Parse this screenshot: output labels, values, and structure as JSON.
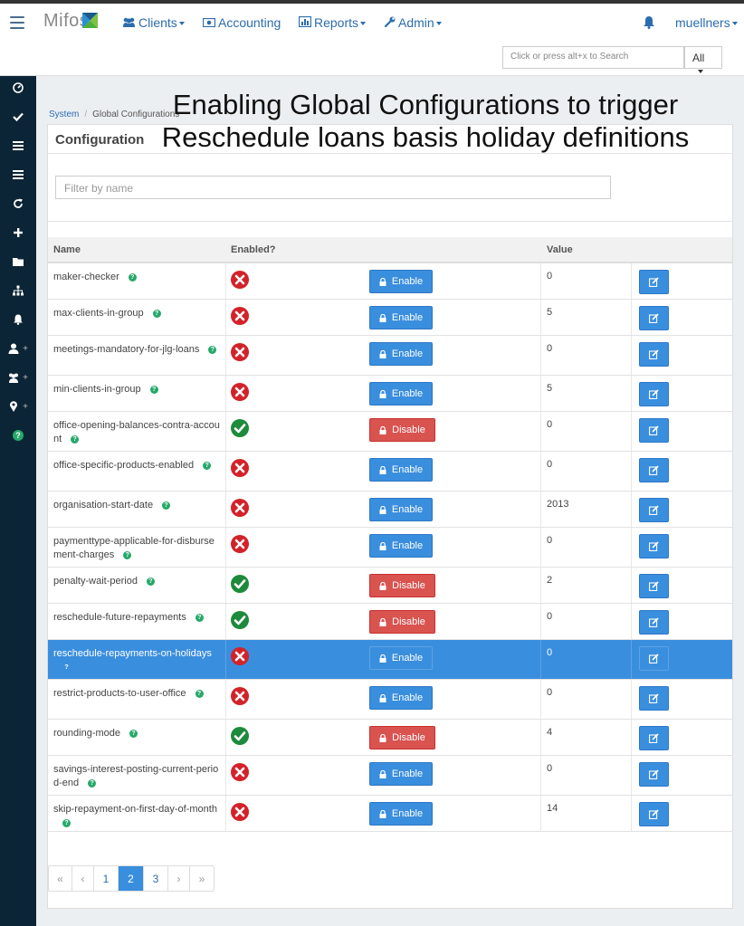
{
  "navbar": {
    "logo": "Mifos",
    "items": [
      {
        "label": "Clients",
        "icon": "users-icon"
      },
      {
        "label": "Accounting",
        "icon": "money-icon"
      },
      {
        "label": "Reports",
        "icon": "bar-chart-icon"
      },
      {
        "label": "Admin",
        "icon": "wrench-icon"
      }
    ],
    "user": "muellners",
    "search_placeholder": "Click or press alt+x to Search",
    "search_scope": "All"
  },
  "breadcrumb": {
    "root": "System",
    "current": "Global Configurations"
  },
  "overlay_caption": {
    "line1": "Enabling Global Configurations to trigger",
    "line2": "Reschedule loans basis holiday definitions"
  },
  "card": {
    "title": "Configuration",
    "filter_placeholder": "Filter by name"
  },
  "table": {
    "headers": {
      "name": "Name",
      "enabled": "Enabled?",
      "value": "Value"
    },
    "rows": [
      {
        "name": "maker-checker",
        "enabled": false,
        "action": "Enable",
        "value": "0"
      },
      {
        "name": "max-clients-in-group",
        "enabled": false,
        "action": "Enable",
        "value": "5"
      },
      {
        "name": "meetings-mandatory-for-jlg-loans",
        "enabled": false,
        "action": "Enable",
        "value": "0"
      },
      {
        "name": "min-clients-in-group",
        "enabled": false,
        "action": "Enable",
        "value": "5"
      },
      {
        "name": "office-opening-balances-contra-account",
        "enabled": true,
        "action": "Disable",
        "value": "0"
      },
      {
        "name": "office-specific-products-enabled",
        "enabled": false,
        "action": "Enable",
        "value": "0"
      },
      {
        "name": "organisation-start-date",
        "enabled": false,
        "action": "Enable",
        "value": "2013"
      },
      {
        "name": "paymenttype-applicable-for-disbursement-charges",
        "enabled": false,
        "action": "Enable",
        "value": "0"
      },
      {
        "name": "penalty-wait-period",
        "enabled": true,
        "action": "Disable",
        "value": "2"
      },
      {
        "name": "reschedule-future-repayments",
        "enabled": true,
        "action": "Disable",
        "value": "0"
      },
      {
        "name": "reschedule-repayments-on-holidays",
        "enabled": false,
        "action": "Enable",
        "value": "0",
        "selected": true
      },
      {
        "name": "restrict-products-to-user-office",
        "enabled": false,
        "action": "Enable",
        "value": "0"
      },
      {
        "name": "rounding-mode",
        "enabled": true,
        "action": "Disable",
        "value": "4"
      },
      {
        "name": "savings-interest-posting-current-period-end",
        "enabled": false,
        "action": "Enable",
        "value": "0"
      },
      {
        "name": "skip-repayment-on-first-day-of-month",
        "enabled": false,
        "action": "Enable",
        "value": "14"
      }
    ]
  },
  "pagination": {
    "items": [
      "«",
      "‹",
      "1",
      "2",
      "3",
      "›",
      "»"
    ],
    "active": "2"
  },
  "colors": {
    "primary": "#3a8ede",
    "danger": "#d9534f",
    "success": "#1e8a3c",
    "error": "#d2232a",
    "sidebar": "#0c2536"
  }
}
